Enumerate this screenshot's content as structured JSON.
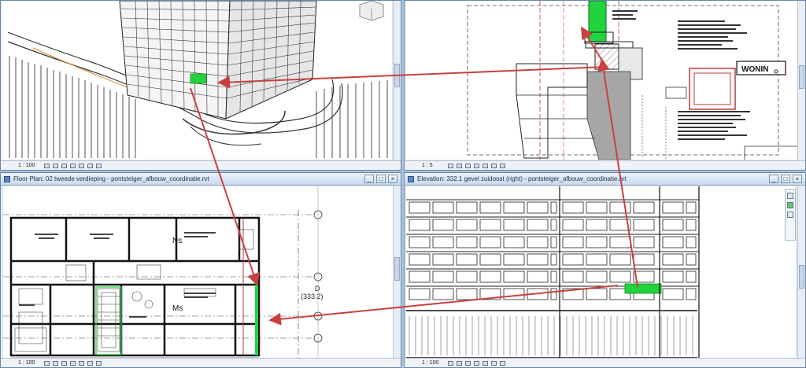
{
  "windows": {
    "top_left": {
      "scale": "1 : 100"
    },
    "top_right": {
      "scale": "1 : 5",
      "tag_label": "WONIN"
    },
    "bottom_left": {
      "title": "Floor Plan: 02 tweede verdieping - pontsteiger_afbouw_coordinatie.rvt",
      "scale": "1 : 100",
      "grid_bubble_label": "D",
      "grid_bubble_sub": "(333.2)",
      "room_tags": [
        "Ns",
        "Ms"
      ]
    },
    "bottom_right": {
      "title": "Elevation: 332.1 gevel zuidoost (right) - pontsteiger_afbouw_coordinatie.rvt",
      "scale": "1 : 100"
    }
  },
  "accent_colors": {
    "highlight": "#22d33d",
    "arrow": "#c94040"
  }
}
